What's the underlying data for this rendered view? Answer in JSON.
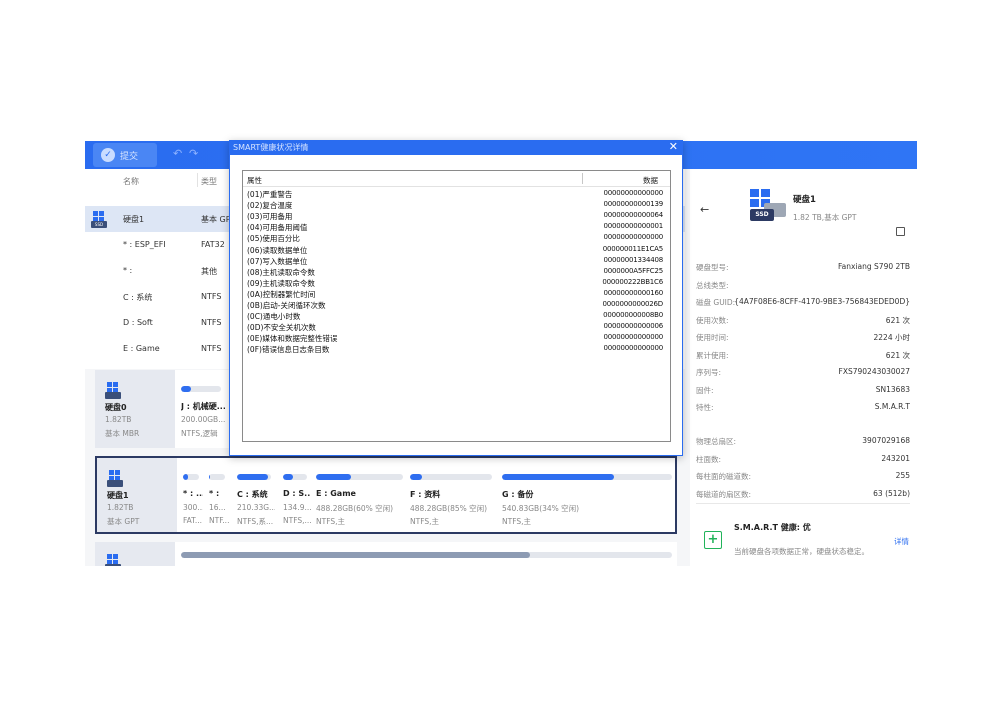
{
  "toolbar": {
    "submit_label": "提交",
    "undo_icon": "↶",
    "redo_icon": "↷"
  },
  "list": {
    "col_name": "名称",
    "col_type": "类型",
    "rows": [
      {
        "name": "硬盘1",
        "type": "基本 GPT",
        "selected": true,
        "is_disk": true
      },
      {
        "name": "* : ESP_EFI",
        "type": "FAT32"
      },
      {
        "name": "* :",
        "type": "其他"
      },
      {
        "name": "C : 系统",
        "type": "NTFS"
      },
      {
        "name": "D : Soft",
        "type": "NTFS"
      },
      {
        "name": "E : Game",
        "type": "NTFS"
      }
    ]
  },
  "disks": [
    {
      "name": "硬盘0",
      "size": "1.82TB",
      "kind": "基本 MBR",
      "partitions": [
        {
          "name": "J : 机械硬...",
          "size": "200.00GB...",
          "fs": "NTFS,逻辑",
          "fill": 0.25
        }
      ]
    },
    {
      "name": "硬盘1",
      "size": "1.82TB",
      "kind": "基本 GPT",
      "partitions": [
        {
          "name": "* : ...",
          "size": "300...",
          "fs": "FAT...",
          "fill": 0.3
        },
        {
          "name": "* :",
          "size": "16...",
          "fs": "NTF...",
          "fill": 0.05
        },
        {
          "name": "C : 系统",
          "size": "210.33G...",
          "fs": "NTFS,系...",
          "fill": 0.9
        },
        {
          "name": "D : S...",
          "size": "134.9...",
          "fs": "NTFS,...",
          "fill": 0.4
        },
        {
          "name": "E : Game",
          "size": "488.28GB(60% 空闲)",
          "fs": "NTFS,主",
          "fill": 0.4
        },
        {
          "name": "F : 资料",
          "size": "488.28GB(85% 空闲)",
          "fs": "NTFS,主",
          "fill": 0.15
        },
        {
          "name": "G : 备份",
          "size": "540.83GB(34% 空闲)",
          "fs": "NTFS,主",
          "fill": 0.66
        }
      ]
    },
    {
      "partitions": [
        {
          "fill": 0.71
        }
      ]
    }
  ],
  "details": {
    "back_icon": "←",
    "disk_name": "硬盘1",
    "disk_sub": "1.82 TB,基本 GPT",
    "ssd_label": "SSD",
    "rows_a": [
      {
        "k": "硬盘型号:",
        "v": "Fanxiang S790 2TB"
      },
      {
        "k": "总线类型:",
        "v": ""
      },
      {
        "k": "磁盘 GUID:",
        "v": "{4A7F08E6-8CFF-4170-9BE3-756843EDED0D}"
      },
      {
        "k": "使用次数:",
        "v": "621 次"
      },
      {
        "k": "使用时间:",
        "v": "2224 小时"
      },
      {
        "k": "累计使用:",
        "v": "621 次"
      },
      {
        "k": "序列号:",
        "v": "FXS790243030027"
      },
      {
        "k": "固件:",
        "v": "SN13683"
      },
      {
        "k": "特性:",
        "v": "S.M.A.R.T"
      }
    ],
    "rows_b": [
      {
        "k": "物理总扇区:",
        "v": "3907029168"
      },
      {
        "k": "柱面数:",
        "v": "243201"
      },
      {
        "k": "每柱面的磁道数:",
        "v": "255"
      },
      {
        "k": "每磁道的扇区数:",
        "v": "63 (512b)"
      }
    ],
    "smart_title": "S.M.A.R.T 健康: 优",
    "smart_desc": "当前硬盘各项数据正常，硬盘状态稳定。",
    "smart_link": "详情"
  },
  "dialog": {
    "title": "SMART健康状况详情",
    "close_icon": "✕",
    "col_attr": "属性",
    "col_data": "数据",
    "rows": [
      {
        "attr": "(01)严重警告",
        "data": "00000000000000"
      },
      {
        "attr": "(02)复合温度",
        "data": "00000000000139"
      },
      {
        "attr": "(03)可用备用",
        "data": "00000000000064"
      },
      {
        "attr": "(04)可用备用阈值",
        "data": "00000000000001"
      },
      {
        "attr": "(05)使用百分比",
        "data": "00000000000000"
      },
      {
        "attr": "(06)读取数据单位",
        "data": "000000011E1CA5"
      },
      {
        "attr": "(07)写入数据单位",
        "data": "00000001334408"
      },
      {
        "attr": "(08)主机读取命令数",
        "data": "0000000A5FFC25"
      },
      {
        "attr": "(09)主机读取命令数",
        "data": "000000222BB1C6"
      },
      {
        "attr": "(0A)控制器繁忙时间",
        "data": "00000000000160"
      },
      {
        "attr": "(0B)启动-关闭循环次数",
        "data": "0000000000026D"
      },
      {
        "attr": "(0C)通电小时数",
        "data": "000000000008B0"
      },
      {
        "attr": "(0D)不安全关机次数",
        "data": "00000000000006"
      },
      {
        "attr": "(0E)媒体和数据完整性错误",
        "data": "00000000000000"
      },
      {
        "attr": "(0F)错误信息日志条目数",
        "data": "00000000000000"
      }
    ]
  }
}
